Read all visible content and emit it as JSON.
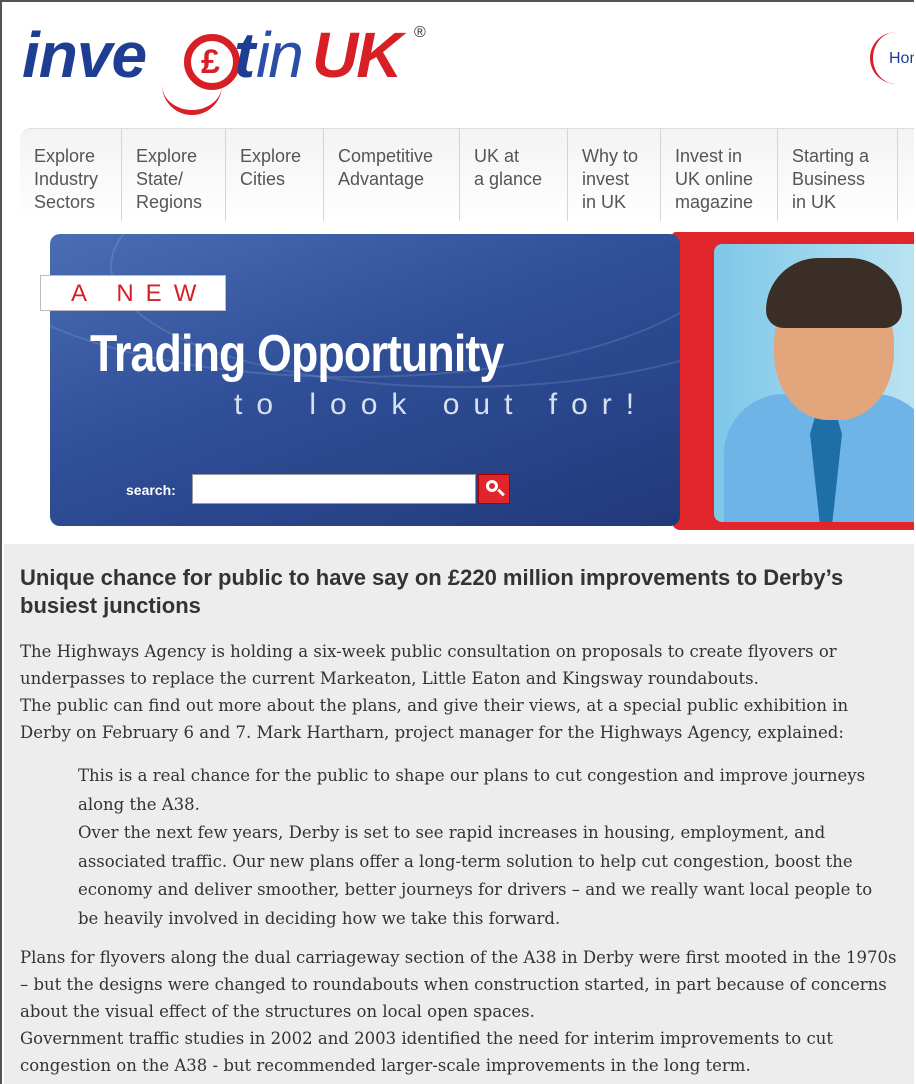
{
  "header": {
    "logo": {
      "part1": "inve",
      "part2": "in",
      "part3": "UK",
      "registered": "®"
    },
    "home_link": "Hom"
  },
  "nav": {
    "items": [
      {
        "label": "Explore\nIndustry\nSectors"
      },
      {
        "label": "Explore\nState/\nRegions"
      },
      {
        "label": "Explore\nCities"
      },
      {
        "label": "Competitive\nAdvantage"
      },
      {
        "label": "UK at\na glance"
      },
      {
        "label": "Why to\ninvest\nin UK"
      },
      {
        "label": "Invest in\nUK online\nmagazine"
      },
      {
        "label": "Starting a\nBusiness\nin UK"
      }
    ]
  },
  "banner": {
    "tag": "A NEW",
    "headline": "Trading Opportunity",
    "subline": "to look out for!",
    "search_label": "search:",
    "search_value": ""
  },
  "article": {
    "title": "Unique chance for public to have say on £220 million improvements to Derby’s busiest junctions",
    "p1": "The Highways Agency is holding a six-week public consultation on proposals to create flyovers or underpasses to replace the current Markeaton, Little Eaton and Kingsway roundabouts.",
    "p1b": "The public can find out more about the plans, and give their views, at a special public exhibition in Derby on February 6 and 7. Mark Hartharn, project manager for the Highways Agency, explained:",
    "quote1": "This is a real chance for the public to shape our plans to cut congestion and improve journeys along the A38.",
    "quote2": "Over the next few years, Derby is set to see rapid increases in housing, employment, and associated traffic. Our new plans offer a long-term solution to help cut congestion, boost the economy and deliver smoother, better journeys for drivers – and we really want local people to be heavily involved in deciding how we take this forward.",
    "p2": "Plans for flyovers along the dual carriageway section of the A38 in Derby were first mooted in the 1970s – but the designs were changed to roundabouts when construction started, in part because of concerns about the visual effect of the structures on local open spaces.",
    "p3": "Government traffic studies in 2002 and 2003 identified the need for interim improvements to cut congestion on the A38 - but recommended larger-scale improvements in the long term."
  }
}
